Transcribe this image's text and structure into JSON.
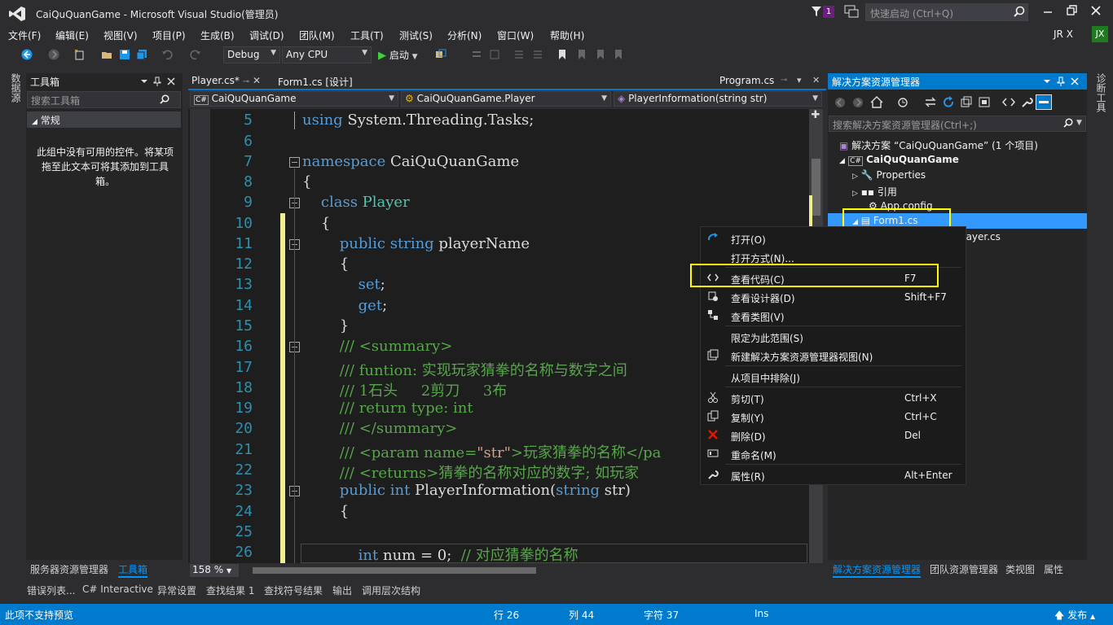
{
  "window": {
    "title": "CaiQuQuanGame - Microsoft Visual Studio(管理员)",
    "notification_count": "1",
    "quick_launch_placeholder": "快速启动 (Ctrl+Q)",
    "user": "JR X",
    "avatar_initials": "JX"
  },
  "menu": [
    "文件(F)",
    "编辑(E)",
    "视图(V)",
    "项目(P)",
    "生成(B)",
    "调试(D)",
    "团队(M)",
    "工具(T)",
    "测试(S)",
    "分析(N)",
    "窗口(W)",
    "帮助(H)"
  ],
  "toolbar": {
    "config": "Debug",
    "platform": "Any CPU",
    "start_label": "启动"
  },
  "left_rail": "数据源",
  "right_rail": "诊断工具",
  "toolbox": {
    "title": "工具箱",
    "search_placeholder": "搜索工具箱",
    "group": "常规",
    "empty_text": "此组中没有可用的控件。将某项拖至此文本可将其添加到工具箱。",
    "bottom_tabs": [
      "服务器资源管理器",
      "工具箱"
    ]
  },
  "editor": {
    "tabs": [
      "Player.cs*",
      "Form1.cs [设计]",
      "Program.cs"
    ],
    "nav": [
      "CaiQuQuanGame",
      "CaiQuQuanGame.Player",
      "PlayerInformation(string str)"
    ],
    "zoom": "158 %",
    "line_numbers": [
      "5",
      "6",
      "7",
      "8",
      "9",
      "10",
      "11",
      "12",
      "13",
      "14",
      "15",
      "16",
      "17",
      "18",
      "19",
      "20",
      "21",
      "22",
      "23",
      "24",
      "25",
      "26"
    ],
    "lines": {
      "l5a": "using",
      "l5b": " System.Threading.Tasks;",
      "l7a": "namespace",
      "l7b": " CaiQuQuanGame",
      "l8": "{",
      "l9a": "    class",
      "l9b": " Player",
      "l10": "    {",
      "l11a": "        public",
      "l11b": " string",
      "l11c": " playerName",
      "l12": "        {",
      "l13a": "            set",
      "l13b": ";",
      "l14a": "            get",
      "l14b": ";",
      "l15": "        }",
      "l16": "        /// <summary>",
      "l17": "        /// funtion: 实现玩家猜拳的名称与数字之间",
      "l18": "        /// 1石头     2剪刀     3布",
      "l19": "        /// return type: int",
      "l20": "        /// </summary>",
      "l21a": "        /// <param name=",
      "l21b": "\"str\"",
      "l21c": ">玩家猜拳的名称</pa",
      "l22": "        /// <returns>猜拳的名称对应的数字; 如玩家",
      "l23a": "        public",
      "l23b": " int",
      "l23c": " PlayerInformation(",
      "l23d": "string",
      "l23e": " str)",
      "l24": "        {",
      "l26a": "            int",
      "l26b": " num = 0;",
      "l26c": "  // 对应猜拳的名称"
    }
  },
  "solution_explorer": {
    "title": "解决方案资源管理器",
    "search_placeholder": "搜索解决方案资源管理器(Ctrl+;)",
    "solution": "解决方案 “CaiQuQuanGame” (1 个项目)",
    "project": "CaiQuQuanGame",
    "items": [
      "Properties",
      "引用",
      "App.config",
      "Form1.cs",
      "Player.cs"
    ],
    "bottom_tabs": [
      "解决方案资源管理器",
      "团队资源管理器",
      "类视图",
      "属性"
    ]
  },
  "context_menu": [
    {
      "label": "打开(O)",
      "shortcut": ""
    },
    {
      "label": "打开方式(N)...",
      "shortcut": ""
    },
    {
      "label": "查看代码(C)",
      "shortcut": "F7"
    },
    {
      "label": "查看设计器(D)",
      "shortcut": "Shift+F7"
    },
    {
      "label": "查看类图(V)",
      "shortcut": ""
    },
    {
      "label": "限定为此范围(S)",
      "shortcut": ""
    },
    {
      "label": "新建解决方案资源管理器视图(N)",
      "shortcut": ""
    },
    {
      "label": "从项目中排除(J)",
      "shortcut": ""
    },
    {
      "label": "剪切(T)",
      "shortcut": "Ctrl+X"
    },
    {
      "label": "复制(Y)",
      "shortcut": "Ctrl+C"
    },
    {
      "label": "删除(D)",
      "shortcut": "Del"
    },
    {
      "label": "重命名(M)",
      "shortcut": ""
    },
    {
      "label": "属性(R)",
      "shortcut": "Alt+Enter"
    }
  ],
  "output_tabs": [
    "错误列表...",
    "C# Interactive",
    "异常设置",
    "查找结果 1",
    "查找符号结果",
    "输出",
    "调用层次结构"
  ],
  "status": {
    "message": "此项不支持预览",
    "row": "行 26",
    "col": "列 44",
    "char": "字符 37",
    "mode": "Ins",
    "publish": "发布"
  },
  "colors": {
    "accent": "#007acc",
    "highlight_box": "#ffff00",
    "keyword": "#569cd6",
    "comment": "#57a64a",
    "type": "#4ec9b0"
  }
}
